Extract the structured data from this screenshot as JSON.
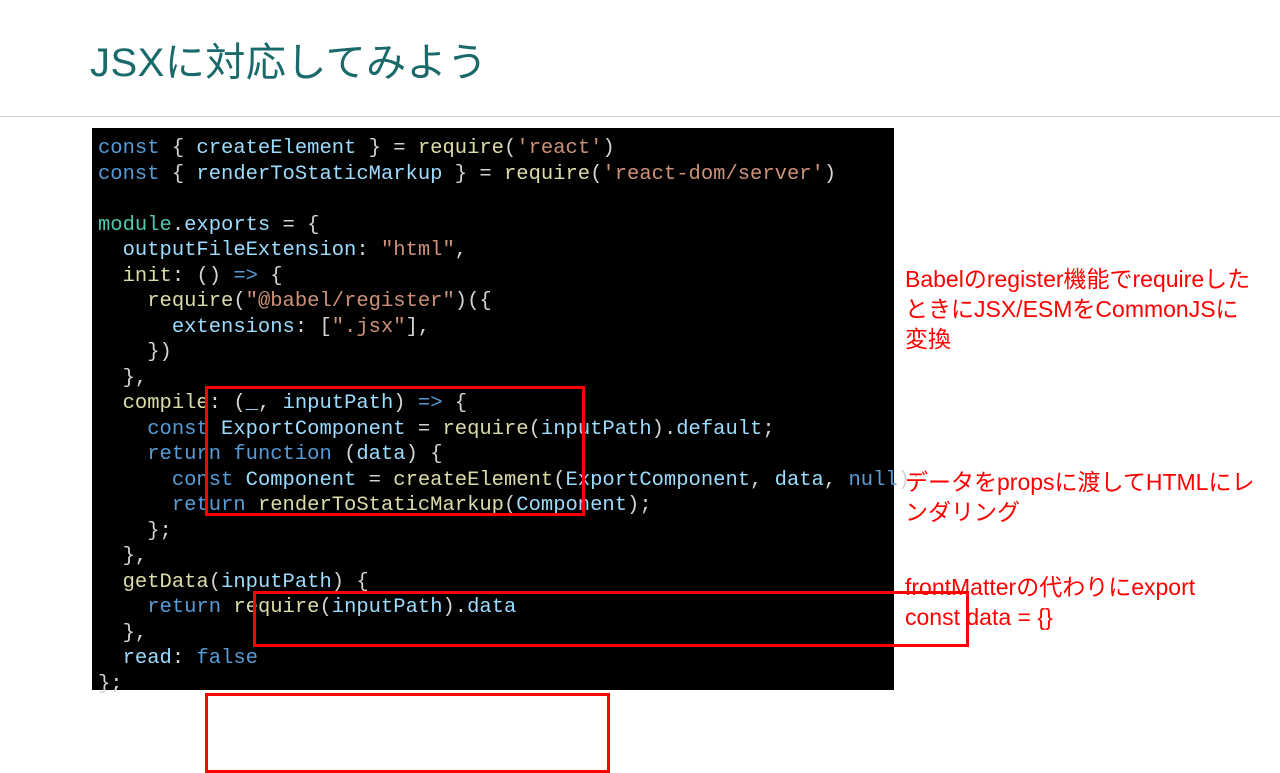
{
  "title": "JSXに対応してみよう",
  "annotations": {
    "a1": "Babelのregister機能でrequireしたときにJSX/ESMをCommonJSに変換",
    "a2": "データをpropsに渡してHTMLにレンダリング",
    "a3": "frontMatterの代わりにexport const data = {}"
  },
  "code": {
    "l1_const": "const",
    "l1_create": "createElement",
    "l1_req": "require",
    "l1_react": "'react'",
    "l2_const": "const",
    "l2_render": "renderToStaticMarkup",
    "l2_req": "require",
    "l2_rds": "'react-dom/server'",
    "l4_module": "module",
    "l4_exports": "exports",
    "l5_ofe": "outputFileExtension",
    "l5_html": "\"html\"",
    "l6_init": "init",
    "l7_req": "require",
    "l7_babel": "\"@babel/register\"",
    "l8_ext": "extensions",
    "l8_jsx": "\".jsx\"",
    "l11_compile": "compile",
    "l11_u": "_",
    "l11_ip": "inputPath",
    "l12_const": "const",
    "l12_ec": "ExportComponent",
    "l12_req": "require",
    "l12_ip": "inputPath",
    "l12_def": "default",
    "l13_ret": "return",
    "l13_fn": "function",
    "l13_data": "data",
    "l14_const": "const",
    "l14_comp": "Component",
    "l14_ce": "createElement",
    "l14_ec": "ExportComponent",
    "l14_data": "data",
    "l14_null": "null",
    "l15_ret": "return",
    "l15_rtsm": "renderToStaticMarkup",
    "l15_comp": "Component",
    "l18_gd": "getData",
    "l18_ip": "inputPath",
    "l19_ret": "return",
    "l19_req": "require",
    "l19_ip": "inputPath",
    "l19_data": "data",
    "l21_read": "read",
    "l21_false": "false"
  }
}
